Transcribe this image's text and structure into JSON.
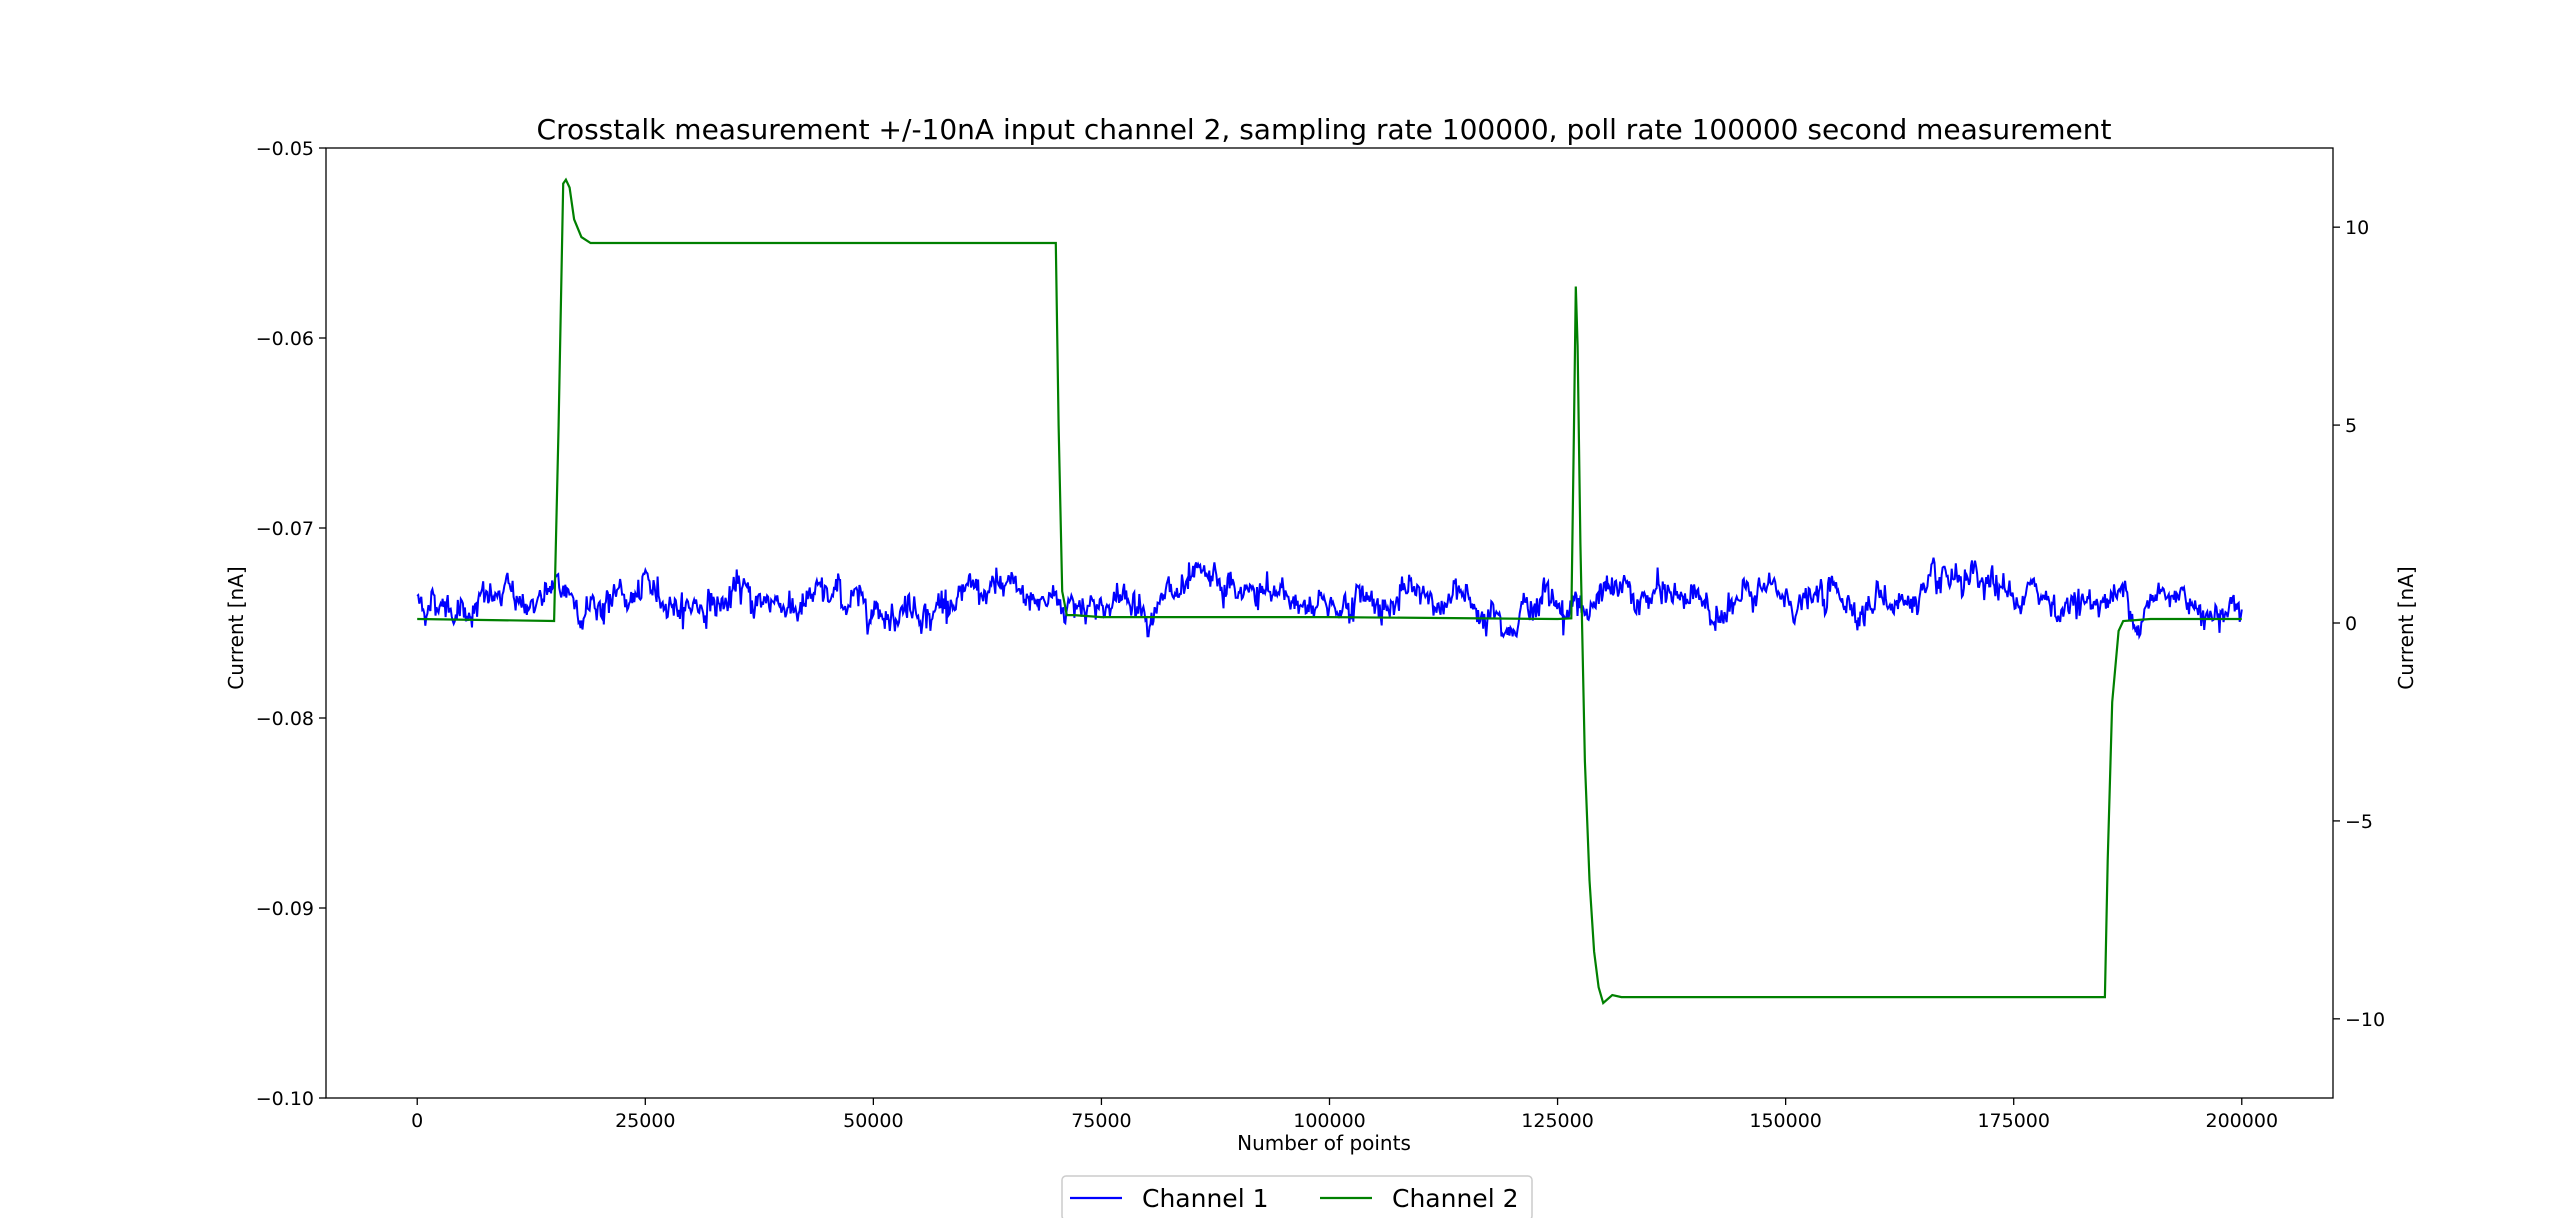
{
  "chart_data": {
    "type": "line",
    "title": "Crosstalk measurement +/-10nA input channel 2, sampling rate 100000, poll rate 100000 second measurement",
    "xlabel": "Number of points",
    "ylabel_left": "Current [nA]",
    "ylabel_right": "Current [nA]",
    "xlim": [
      -10000,
      210000
    ],
    "ylim_left": [
      -0.1,
      -0.05
    ],
    "ylim_right": [
      -12.0,
      12.0
    ],
    "x_ticks": [
      0,
      25000,
      50000,
      75000,
      100000,
      125000,
      150000,
      175000,
      200000
    ],
    "x_tick_labels": [
      "0",
      "25000",
      "50000",
      "75000",
      "100000",
      "125000",
      "150000",
      "175000",
      "200000"
    ],
    "y_left_ticks": [
      -0.1,
      -0.09,
      -0.08,
      -0.07,
      -0.06,
      -0.05
    ],
    "y_left_tick_labels": [
      "−0.10",
      "−0.09",
      "−0.08",
      "−0.07",
      "−0.06",
      "−0.05"
    ],
    "y_right_ticks": [
      -10,
      -5,
      0,
      5,
      10
    ],
    "y_right_tick_labels": [
      "−10",
      "−5",
      "0",
      "5",
      "10"
    ],
    "grid": false,
    "legend": {
      "placement": "bottom-center, outside plot",
      "entries": [
        "Channel 1",
        "Channel 2"
      ]
    },
    "series": [
      {
        "name": "Channel 1",
        "axis": "left",
        "color": "#0000ff",
        "description_values": {
          "mean": -0.0738,
          "min": -0.0757,
          "max": -0.0715
        },
        "x_start": 0,
        "x_end": 200000,
        "n_points": 1800,
        "noise_mean": -0.0738,
        "noise_std": 0.00055
      },
      {
        "name": "Channel 2",
        "axis": "right",
        "color": "#008000",
        "x": [
          0,
          15000,
          15500,
          16000,
          16300,
          16700,
          17200,
          18000,
          19000,
          20000,
          30000,
          50000,
          70000,
          70300,
          70700,
          71200,
          72000,
          75000,
          100000,
          125000,
          126500,
          126800,
          127000,
          127200,
          127500,
          128000,
          128500,
          129000,
          129500,
          130000,
          131000,
          132000,
          150000,
          170000,
          185000,
          185300,
          185800,
          186500,
          187000,
          190000,
          200000
        ],
        "y": [
          0.1,
          0.05,
          5.0,
          11.1,
          11.2,
          11.0,
          10.2,
          9.75,
          9.6,
          9.6,
          9.6,
          9.6,
          9.6,
          5.0,
          0.8,
          0.2,
          0.2,
          0.15,
          0.15,
          0.1,
          0.12,
          5.0,
          8.5,
          7.0,
          2.0,
          -3.5,
          -6.5,
          -8.3,
          -9.2,
          -9.6,
          -9.4,
          -9.45,
          -9.45,
          -9.45,
          -9.45,
          -6.0,
          -2.0,
          -0.2,
          0.05,
          0.1,
          0.1
        ]
      }
    ]
  }
}
